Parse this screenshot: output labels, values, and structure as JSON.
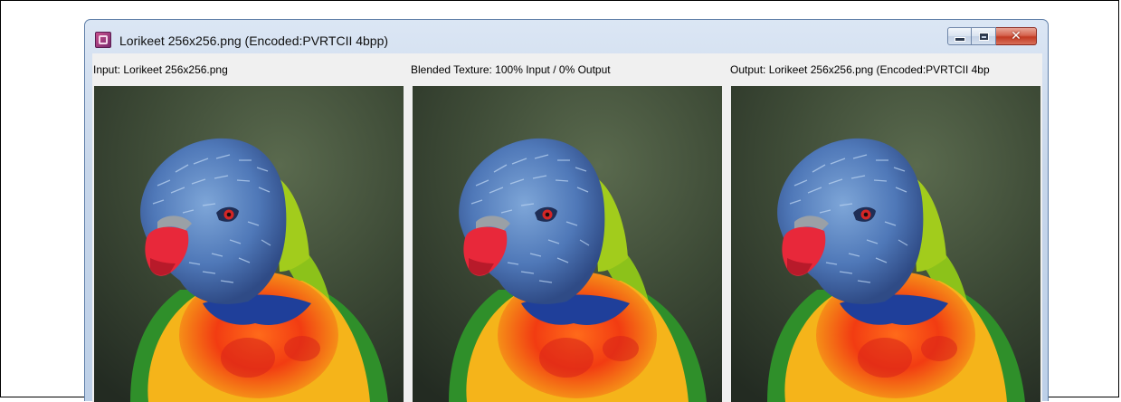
{
  "window": {
    "title": "Lorikeet 256x256.png (Encoded:PVRTCII 4bpp)",
    "buttons": [
      "minimize",
      "maximize",
      "close"
    ]
  },
  "panes": [
    {
      "label": "Input: Lorikeet 256x256.png"
    },
    {
      "label": "Blended Texture: 100% Input / 0% Output"
    },
    {
      "label": "Output: Lorikeet 256x256.png (Encoded:PVRTCII 4bp"
    }
  ],
  "image_subject": "rainbow lorikeet",
  "colors": {
    "title_bar": "#c7d6ea",
    "client_bg": "#f0f0f0",
    "close_button": "#c23a22"
  }
}
